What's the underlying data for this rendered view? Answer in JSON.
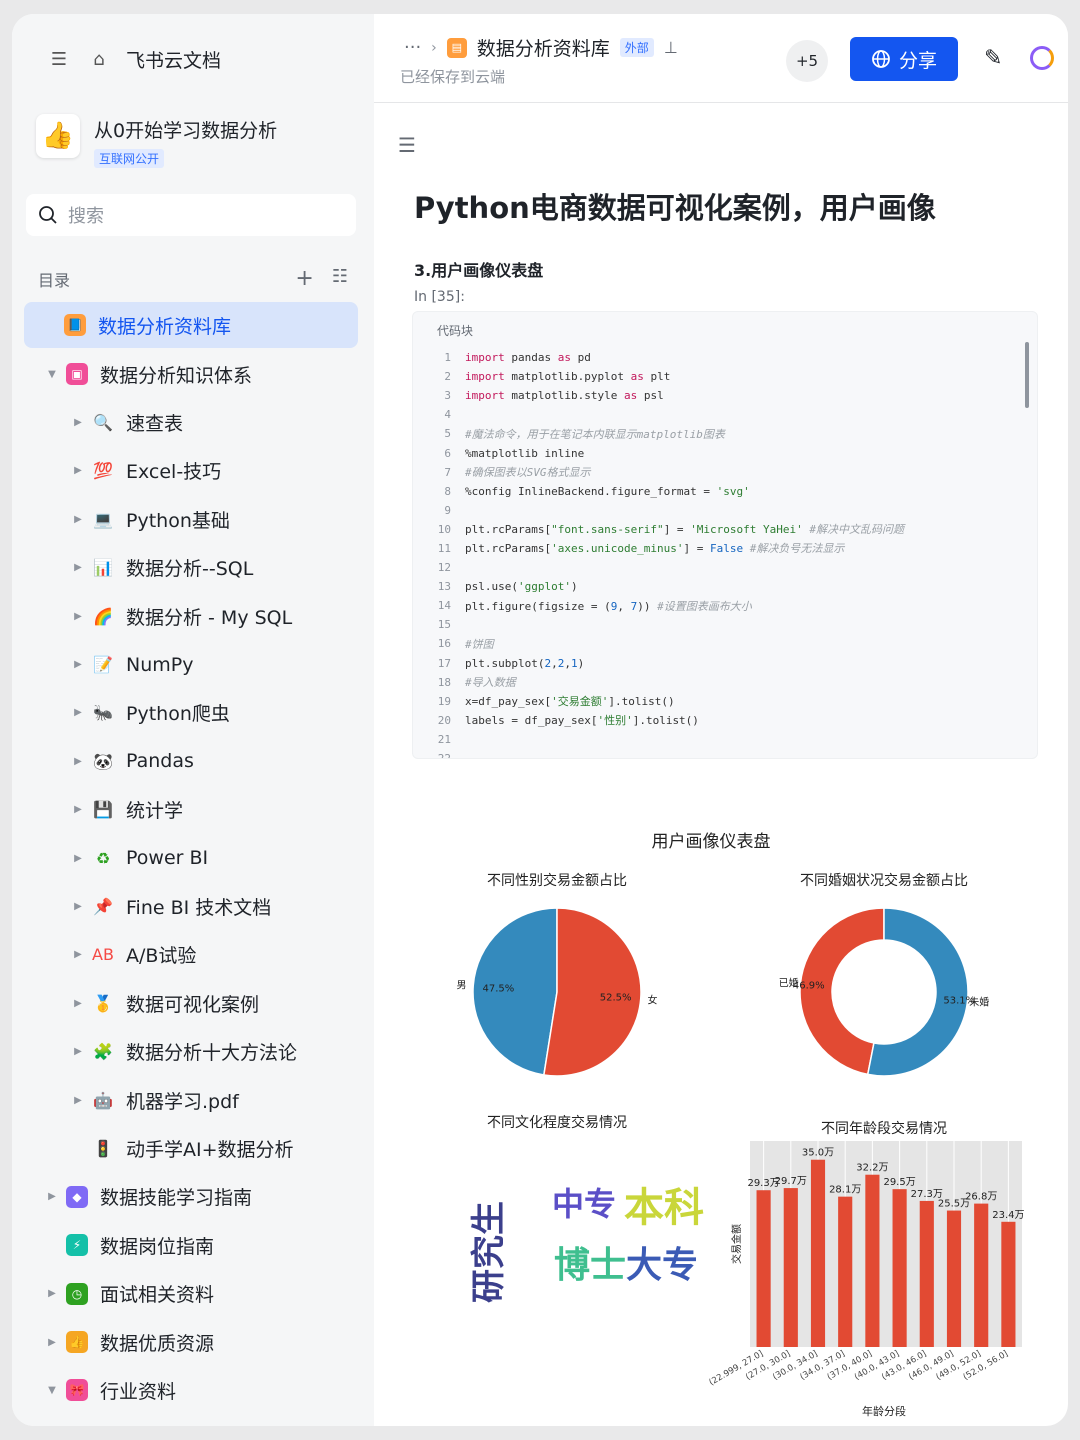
{
  "sidebar": {
    "brand": "飞书云文档",
    "space_title": "从0开始学习数据分析",
    "space_badge": "互联网公开",
    "search_placeholder": "搜索",
    "toc_label": "目录",
    "items": [
      {
        "label": "数据分析资料库",
        "level": 1,
        "icon": "📘",
        "color": "#ff9d3d",
        "active": true,
        "caret": ""
      },
      {
        "label": "数据分析知识体系",
        "level": 1,
        "icon": "▣",
        "color": "#f04e98",
        "caret": "▼"
      },
      {
        "label": "速查表",
        "level": 2,
        "icon": "🔍",
        "color": "#3370ff",
        "caret": "▶"
      },
      {
        "label": "Excel-技巧",
        "level": 2,
        "icon": "💯",
        "color": "#f54a45",
        "caret": "▶"
      },
      {
        "label": "Python基础",
        "level": 2,
        "icon": "💻",
        "color": "#2b8ae2",
        "caret": "▶"
      },
      {
        "label": "数据分析--SQL",
        "level": 2,
        "icon": "📊",
        "color": "#3370ff",
        "caret": "▶"
      },
      {
        "label": "数据分析 - My SQL",
        "level": 2,
        "icon": "🌈",
        "color": "#ff7d00",
        "caret": "▶"
      },
      {
        "label": "NumPy",
        "level": 2,
        "icon": "📝",
        "color": "#f54a45",
        "caret": "▶"
      },
      {
        "label": "Python爬虫",
        "level": 2,
        "icon": "🐜",
        "color": "#5b5b5b",
        "caret": "▶"
      },
      {
        "label": "Pandas",
        "level": 2,
        "icon": "🐼",
        "color": "#555555",
        "caret": "▶"
      },
      {
        "label": "统计学",
        "level": 2,
        "icon": "💾",
        "color": "#3f3f9f",
        "caret": "▶"
      },
      {
        "label": "Power BI",
        "level": 2,
        "icon": "♻",
        "color": "#2ea121",
        "caret": "▶"
      },
      {
        "label": "Fine BI 技术文档",
        "level": 2,
        "icon": "📌",
        "color": "#f54a45",
        "caret": "▶"
      },
      {
        "label": "A/B试验",
        "level": 2,
        "icon": "AB",
        "color": "#f54a45",
        "caret": "▶"
      },
      {
        "label": "数据可视化案例",
        "level": 2,
        "icon": "🥇",
        "color": "#f5a623",
        "caret": "▶"
      },
      {
        "label": "数据分析十大方法论",
        "level": 2,
        "icon": "🧩",
        "color": "#7dc856",
        "caret": "▶"
      },
      {
        "label": "机器学习.pdf",
        "level": 2,
        "icon": "🤖",
        "color": "#555555",
        "caret": "▶"
      },
      {
        "label": "动手学AI+数据分析",
        "level": 2,
        "icon": "🚦",
        "color": "#555555",
        "caret": ""
      },
      {
        "label": "数据技能学习指南",
        "level": 1,
        "icon": "◆",
        "color": "#7f6af5",
        "caret": "▶"
      },
      {
        "label": "数据岗位指南",
        "level": 1,
        "icon": "⚡",
        "color": "#14c0a8",
        "caret": ""
      },
      {
        "label": "面试相关资料",
        "level": 1,
        "icon": "◷",
        "color": "#2ea121",
        "caret": "▶"
      },
      {
        "label": "数据优质资源",
        "level": 1,
        "icon": "👍",
        "color": "#f5a623",
        "caret": "▶"
      },
      {
        "label": "行业资料",
        "level": 1,
        "icon": "🎀",
        "color": "#f04e98",
        "caret": "▼"
      }
    ]
  },
  "header": {
    "breadcrumb_more": "···",
    "doc_title": "数据分析资料库",
    "ext_badge": "外部",
    "saved_status": "已经保存到云端",
    "collaborators": "+5",
    "share_label": "分享"
  },
  "doc": {
    "title": "Python电商数据可视化案例，用户画像",
    "section": "3.用户画像仪表盘",
    "cell_label": "In [35]:",
    "code_block_label": "代码块",
    "code_lines": [
      {
        "n": "1",
        "html": "<span class='kw'>import</span> pandas <span class='kw'>as</span> pd"
      },
      {
        "n": "2",
        "html": "<span class='kw'>import</span> matplotlib.pyplot <span class='kw'>as</span> plt"
      },
      {
        "n": "3",
        "html": "<span class='kw'>import</span> matplotlib.style <span class='kw'>as</span> psl"
      },
      {
        "n": "4",
        "html": ""
      },
      {
        "n": "5",
        "html": "<span class='cm'>#魔法命令，用于在笔记本内联显示matplotlib图表</span>"
      },
      {
        "n": "6",
        "html": "%matplotlib inline"
      },
      {
        "n": "7",
        "html": "<span class='cm'>#确保图表以SVG格式显示</span>"
      },
      {
        "n": "8",
        "html": "%config InlineBackend.figure_format = <span class='str'>'svg'</span>"
      },
      {
        "n": "9",
        "html": ""
      },
      {
        "n": "10",
        "html": "plt.rcParams[<span class='str'>\"font.sans-serif\"</span>] = <span class='str'>'Microsoft YaHei'</span> <span class='cm'>#解决中文乱码问题</span>"
      },
      {
        "n": "11",
        "html": "plt.rcParams[<span class='str'>'axes.unicode_minus'</span>] = <span class='kw2'>False</span> <span class='cm'>#解决负号无法显示</span>"
      },
      {
        "n": "12",
        "html": ""
      },
      {
        "n": "13",
        "html": "psl.use(<span class='str'>'ggplot'</span>)"
      },
      {
        "n": "14",
        "html": "plt.figure(figsize = (<span class='kw2'>9</span>, <span class='kw2'>7</span>)) <span class='cm'>#设置图表画布大小</span>"
      },
      {
        "n": "15",
        "html": ""
      },
      {
        "n": "16",
        "html": "<span class='cm'>#饼图</span>"
      },
      {
        "n": "17",
        "html": "plt.subplot(<span class='kw2'>2</span>,<span class='kw2'>2</span>,<span class='kw2'>1</span>)"
      },
      {
        "n": "18",
        "html": "<span class='cm'>#导入数据</span>"
      },
      {
        "n": "19",
        "html": "x=df_pay_sex[<span class='str'>'交易金额'</span>].tolist()"
      },
      {
        "n": "20",
        "html": "labels = df_pay_sex[<span class='str'>'性别'</span>].tolist()"
      },
      {
        "n": "21",
        "html": ""
      },
      {
        "n": "22",
        "html": ""
      }
    ]
  },
  "chart_data": {
    "suptitle": "用户画像仪表盘",
    "charts": [
      {
        "type": "pie",
        "title": "不同性别交易金额占比",
        "slices": [
          {
            "label": "男",
            "value": 47.5,
            "pct": "47.5%",
            "color": "#348abd"
          },
          {
            "label": "女",
            "value": 52.5,
            "pct": "52.5%",
            "color": "#e24a33"
          }
        ]
      },
      {
        "type": "donut",
        "title": "不同婚姻状况交易金额占比",
        "slices": [
          {
            "label": "已婚",
            "value": 46.9,
            "pct": "46.9%",
            "color": "#e24a33"
          },
          {
            "label": "未婚",
            "value": 53.1,
            "pct": "53.1%",
            "color": "#348abd"
          }
        ]
      },
      {
        "type": "wordcloud",
        "title": "不同文化程度交易情况",
        "words": [
          {
            "text": "研究生",
            "color": "#3b3f8c"
          },
          {
            "text": "中专",
            "color": "#5b4fc7"
          },
          {
            "text": "本科",
            "color": "#c9d63a"
          },
          {
            "text": "博士",
            "color": "#3fbf8f"
          },
          {
            "text": "大专",
            "color": "#3b5bb5"
          }
        ]
      },
      {
        "type": "bar",
        "title": "不同年龄段交易情况",
        "xlabel": "年龄分段",
        "ylabel": "交易金额",
        "ylim": [
          0,
          38.5
        ],
        "categories": [
          "(22.999, 27.0]",
          "(27.0, 30.0]",
          "(30.0, 34.0]",
          "(34.0, 37.0]",
          "(37.0, 40.0]",
          "(40.0, 43.0]",
          "(43.0, 46.0]",
          "(46.0, 49.0]",
          "(49.0, 52.0]",
          "(52.0, 56.0]"
        ],
        "values": [
          29.3,
          29.7,
          35.0,
          28.1,
          32.2,
          29.5,
          27.3,
          25.5,
          26.8,
          23.4
        ],
        "labels": [
          "29.3万",
          "29.7万",
          "35.0万",
          "28.1万",
          "32.2万",
          "29.5万",
          "27.3万",
          "25.5万",
          "26.8万",
          "23.4万"
        ],
        "color": "#e24a33"
      }
    ]
  }
}
